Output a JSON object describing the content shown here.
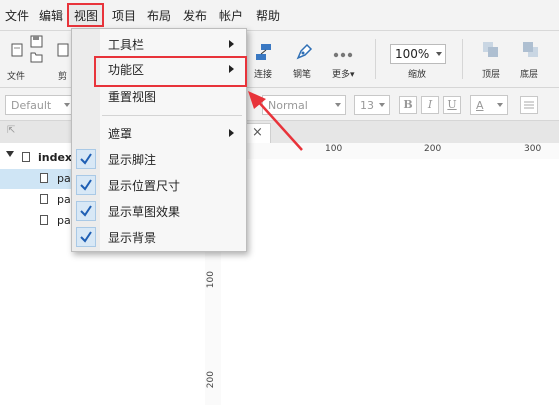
{
  "menubar": {
    "items": [
      "文件",
      "编辑",
      "视图",
      "项目",
      "布局",
      "发布",
      "帐户",
      "帮助"
    ]
  },
  "toolbar": {
    "file_label": "文件",
    "cut_label": "剪",
    "connect_label": "连接",
    "pen_label": "钢笔",
    "more_label": "更多▾",
    "zoom_value": "100%",
    "zoom_label": "缩放",
    "top_label": "顶层",
    "bottom_label": "底层"
  },
  "formatbar": {
    "style_value": "Default",
    "font_value": "Normal",
    "size_value": "13",
    "bold": "B",
    "italic": "I",
    "underline": "U",
    "font_color": "A"
  },
  "sidebar": {
    "root": "index",
    "pages": [
      "pa",
      "pa",
      "pa"
    ]
  },
  "tab": {
    "close": "×"
  },
  "rulers": {
    "h": [
      "100",
      "200",
      "300"
    ],
    "v": [
      "100",
      "200"
    ]
  },
  "view_menu": {
    "toolbar": "工具栏",
    "ribbon": "功能区",
    "reset_view": "重置视图",
    "mask": "遮罩",
    "show_footnotes": "显示脚注",
    "show_position_size": "显示位置尺寸",
    "show_sketch_effect": "显示草图效果",
    "show_background": "显示背景",
    "checked": [
      true,
      true,
      true,
      true
    ]
  },
  "colors": {
    "highlight": "#e8333a",
    "selection": "#cfe5f5",
    "check": "#1f5fb4"
  }
}
